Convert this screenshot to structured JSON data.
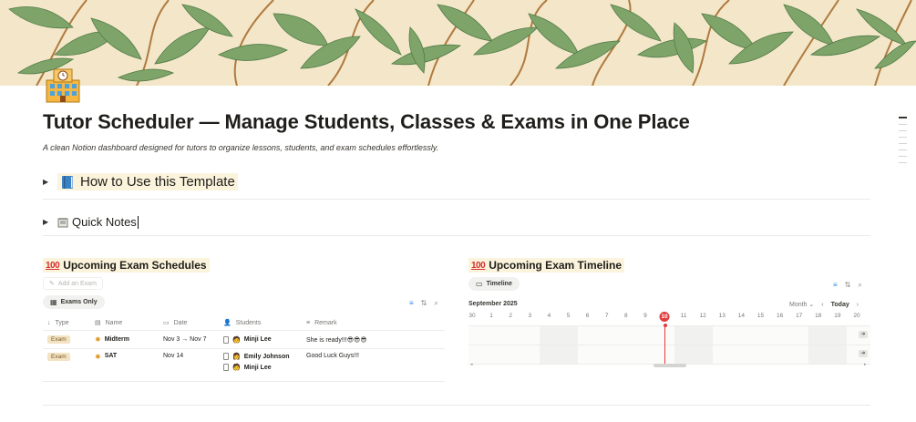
{
  "page": {
    "title": "Tutor Scheduler — Manage Students, Classes & Exams in One Place",
    "subtitle": "A clean Notion dashboard designed for tutors to organize lessons, students, and exam schedules effortlessly.",
    "icon": "school-building-icon"
  },
  "toggles": [
    {
      "label": "How to Use this Template",
      "icon": "blue-book-icon"
    },
    {
      "label": "Quick Notes",
      "icon": "notepad-icon"
    }
  ],
  "exam_db": {
    "title": "Upcoming Exam Schedules",
    "icon": "hundred-points-icon",
    "add_label": "Add an Exam",
    "view_label": "Exams Only",
    "columns": [
      "Type",
      "Name",
      "Date",
      "Students",
      "Remark"
    ],
    "rows": [
      {
        "type": "Exam",
        "name": "Midterm",
        "date": "Nov 3 → Nov 7",
        "students": [
          "Minji Lee"
        ],
        "remark": "She is ready!!!😎😎😎"
      },
      {
        "type": "Exam",
        "name": "SAT",
        "date": "Nov 14",
        "students": [
          "Emily Johnson",
          "Minji Lee"
        ],
        "remark": "Good Luck Guys!!!"
      }
    ]
  },
  "timeline": {
    "title": "Upcoming Exam Timeline",
    "icon": "hundred-points-icon",
    "view_label": "Timeline",
    "month": "September 2025",
    "scale": "Month",
    "today_label": "Today",
    "days": [
      "30",
      "1",
      "2",
      "3",
      "4",
      "5",
      "6",
      "7",
      "8",
      "9",
      "10",
      "11",
      "12",
      "13",
      "14",
      "15",
      "16",
      "17",
      "18",
      "19",
      "20"
    ],
    "current_day": "10"
  },
  "colors": {
    "accent_blue": "#2383e2",
    "today_red": "#e03e3e",
    "tag_bg": "#f3e3c2",
    "highlight_bg": "#fbf3db"
  }
}
